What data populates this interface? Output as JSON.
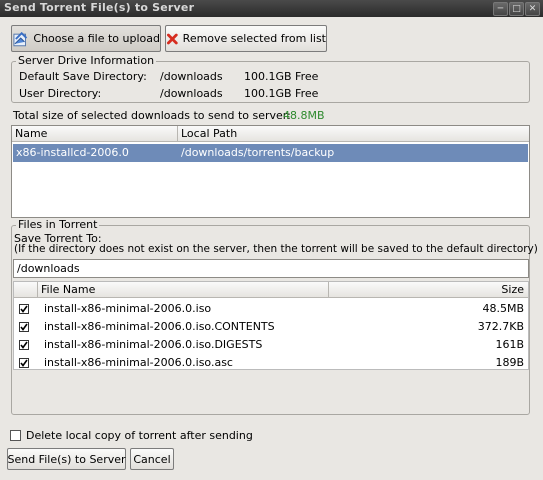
{
  "window": {
    "title": "Send Torrent File(s) to Server"
  },
  "toolbar": {
    "choose_label": "Choose a file to upload",
    "remove_label": "Remove selected from list"
  },
  "server_info": {
    "legend": "Server Drive Information",
    "rows": [
      {
        "label": "Default Save Directory:",
        "path": "/downloads",
        "free": "100.1GB Free"
      },
      {
        "label": "User Directory:",
        "path": "/downloads",
        "free": "100.1GB Free"
      }
    ]
  },
  "total": {
    "label": "Total size of selected downloads to send to server:",
    "value": "48.8MB"
  },
  "torrent_list": {
    "columns": [
      "Name",
      "Local Path"
    ],
    "rows": [
      {
        "name": "x86-installcd-2006.0",
        "path": "/downloads/torrents/backup"
      }
    ]
  },
  "files": {
    "legend": "Files in Torrent",
    "save_to_label": "Save Torrent To:",
    "save_to_note": "(If the directory does not exist on the server, then the torrent will be saved to the default directory)",
    "save_to_value": "/downloads",
    "columns": [
      "File Name",
      "Size"
    ],
    "rows": [
      {
        "name": "install-x86-minimal-2006.0.iso",
        "size": "48.5MB",
        "checked": true
      },
      {
        "name": "install-x86-minimal-2006.0.iso.CONTENTS",
        "size": "372.7KB",
        "checked": true
      },
      {
        "name": "install-x86-minimal-2006.0.iso.DIGESTS",
        "size": "161B",
        "checked": true
      },
      {
        "name": "install-x86-minimal-2006.0.iso.asc",
        "size": "189B",
        "checked": true
      }
    ]
  },
  "delete_local": {
    "label": "Delete local copy of torrent after sending",
    "checked": false
  },
  "actions": {
    "send_label": "Send File(s) to Server",
    "cancel_label": "Cancel"
  },
  "colors": {
    "selection": "#6e8bb8",
    "total_value": "#2e8a2e",
    "remove_icon": "#d62d20"
  }
}
